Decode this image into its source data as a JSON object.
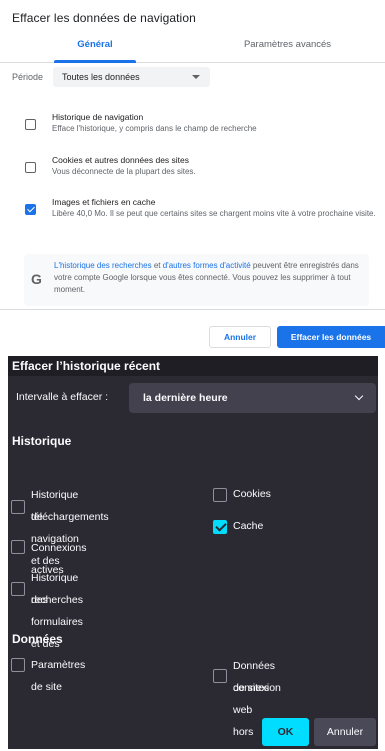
{
  "chrome": {
    "title": "Effacer les données de navigation",
    "tabs": {
      "general": "Général",
      "advanced": "Paramètres avancés"
    },
    "period": {
      "label": "Période",
      "value": "Toutes les données"
    },
    "items": [
      {
        "title": "Historique de navigation",
        "desc": "Efface l'historique, y compris dans le champ de recherche",
        "checked": false
      },
      {
        "title": "Cookies et autres données des sites",
        "desc": "Vous déconnecte de la plupart des sites.",
        "checked": false
      },
      {
        "title": "Images et fichiers en cache",
        "desc": "Libère 40,0 Mo. Il se peut que certains sites se chargent moins vite à votre prochaine visite.",
        "checked": true
      }
    ],
    "info": {
      "link1": "L'historique des recherches",
      "mid": " et ",
      "link2": "d'autres formes d'activité",
      "rest": " peuvent être enregistrés dans votre compte Google lorsque vous êtes connecté. Vous pouvez les supprimer à tout moment."
    },
    "buttons": {
      "cancel": "Annuler",
      "clear": "Effacer les données"
    }
  },
  "firefox": {
    "title": "Effacer l’historique récent",
    "range": {
      "label": "Intervalle à effacer :",
      "value": "la dernière heure"
    },
    "history_heading": "Historique",
    "history_items": {
      "browsing": {
        "label_line1": "Historique de navigation et des",
        "label_line2": "téléchargements",
        "checked": false
      },
      "cookies": {
        "label": "Cookies",
        "checked": false
      },
      "cache": {
        "label": "Cache",
        "checked": true
      },
      "active_logins": {
        "label": "Connexions actives",
        "checked": false
      },
      "forms": {
        "label_line1": "Historique des formulaires et des",
        "label_line2": "recherches",
        "checked": false
      }
    },
    "data_heading": "Données",
    "data_items": {
      "site_settings": {
        "label": "Paramètres de site",
        "checked": false
      },
      "offline": {
        "label_line1": "Données de sites web hors",
        "label_line2": "connexion",
        "checked": false
      }
    },
    "buttons": {
      "ok": "OK",
      "cancel": "Annuler"
    },
    "colors": {
      "background": "#2b2a33",
      "accent": "#00ddff"
    }
  },
  "colors": {
    "chrome_accent": "#1a73e8"
  }
}
